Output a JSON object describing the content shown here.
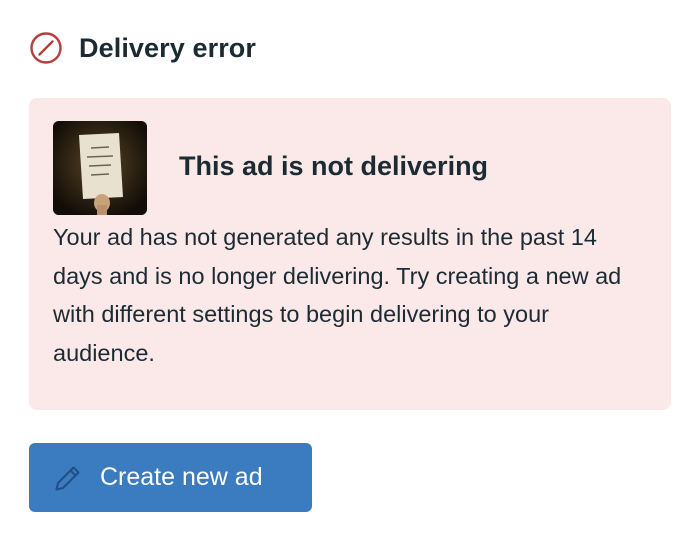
{
  "header": {
    "icon": "prohibited-circle-icon",
    "title": "Delivery error",
    "icon_color": "#b3403c"
  },
  "ad_status": {
    "thumbnail": "ad-thumbnail-image",
    "title": "This ad is not delivering",
    "description": "Your ad has not generated any results in the past 14 days and is no longer delivering. Try creating a new ad with different settings to begin delivering to your audience.",
    "background_color": "#fbe8e8"
  },
  "actions": {
    "create_button_label": "Create new ad",
    "create_button_icon": "pencil-icon",
    "button_color": "#3b7bbf"
  }
}
